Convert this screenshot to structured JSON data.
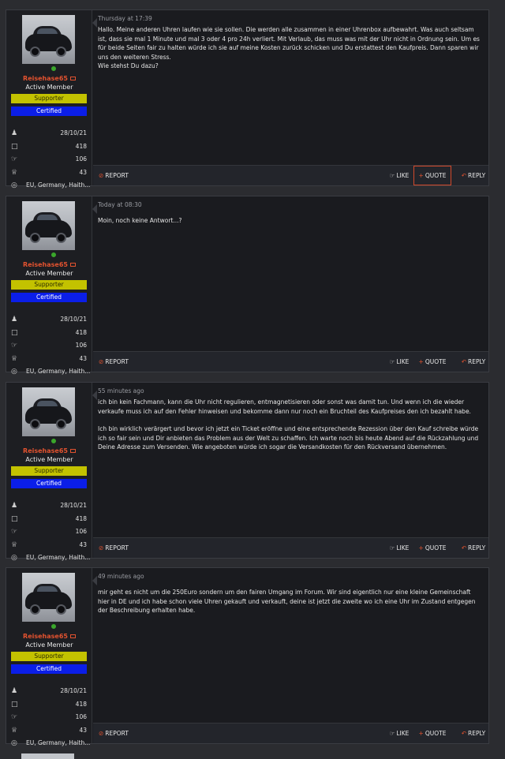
{
  "user": {
    "name": "Reisehase65",
    "title": "Active Member",
    "banners": {
      "supporter": "Supporter",
      "certified": "Certified"
    },
    "stats": {
      "joined": "28/10/21",
      "messages": "418",
      "reactions": "106",
      "points": "43",
      "location": "EU, Germany, Haith..."
    },
    "icons": {
      "joined": "user-icon",
      "messages": "messages-icon",
      "reactions": "thumbs-up-icon",
      "points": "trophy-icon",
      "location": "map-pin-icon",
      "inbox": "envelope-icon"
    }
  },
  "actions": {
    "report": "REPORT",
    "like": "LIKE",
    "quote": "QUOTE",
    "reply": "REPLY"
  },
  "posts": [
    {
      "date": "Thursday at 17:39",
      "paragraphs": [
        "Hallo. Meine anderen Uhren laufen wie sie sollen. Die werden alle zusammen in einer Uhrenbox aufbewahrt. Was auch seltsam ist, dass sie mal 1 Minute und mal 3 oder 4 pro 24h verliert. Mit Verlaub, das muss was mit der Uhr nicht in Ordnung sein. Um es für beide Seiten fair zu halten würde ich sie auf meine Kosten zurück schicken und Du erstattest den Kaufpreis. Dann sparen wir uns den weiteren Stress.\nWie stehst Du dazu?"
      ],
      "quote_active": true
    },
    {
      "date": "Today at 08:30",
      "paragraphs": [
        "Moin, noch keine Antwort...?"
      ],
      "quote_active": false
    },
    {
      "date": "55 minutes ago",
      "paragraphs": [
        "ich bin kein Fachmann, kann die Uhr nicht regulieren, entmagnetisieren oder sonst was damit tun. Und wenn ich die wieder verkaufe muss ich auf den Fehler hinweisen und bekomme dann nur noch ein Bruchteil des Kaufpreises den ich bezahlt habe.",
        "Ich bin wirklich verärgert und bevor ich jetzt ein Ticket eröffne und eine entsprechende Rezession über den Kauf schreibe würde ich so fair sein und Dir anbieten das Problem aus der Welt zu schaffen. Ich warte noch bis heute Abend auf die Rückzahlung und Deine Adresse zum Versenden. Wie angeboten würde ich sogar die Versandkosten für den Rückversand übernehmen."
      ],
      "quote_active": false
    },
    {
      "date": "49 minutes ago",
      "paragraphs": [
        "mir geht es nicht um die 250Euro sondern um den fairen Umgang im Forum. Wir sind eigentlich nur eine kleine Gemeinschaft hier in DE und ich habe schon viele Uhren gekauft und verkauft, deine ist jetzt die zweite wo ich eine Uhr im Zustand entgegen der Beschreibung erhalten habe."
      ],
      "quote_active": false
    }
  ]
}
